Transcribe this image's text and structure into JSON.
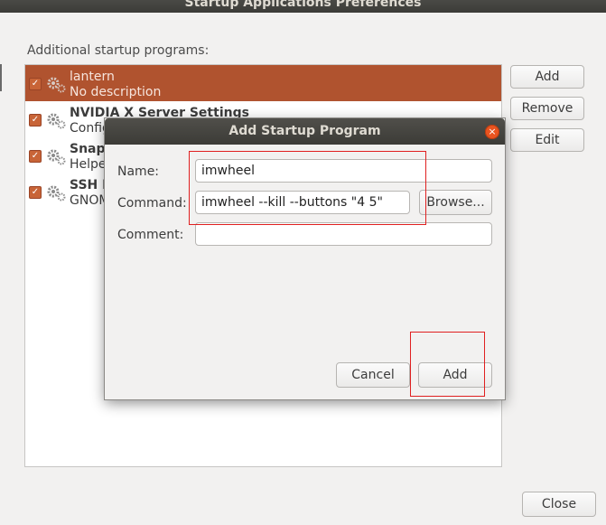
{
  "window": {
    "title": "Startup Applications Preferences"
  },
  "list_label": "Additional startup programs:",
  "programs": [
    {
      "name": "lantern",
      "description": "No description",
      "checked": true,
      "selected": true
    },
    {
      "name": "NVIDIA X Server Settings",
      "description": "Configu",
      "checked": true,
      "selected": false
    },
    {
      "name": "Snap",
      "description": "Helpe",
      "checked": true,
      "selected": false
    },
    {
      "name": "SSH K",
      "description": "GNOM",
      "checked": true,
      "selected": false
    }
  ],
  "side_buttons": {
    "add": "Add",
    "remove": "Remove",
    "edit": "Edit"
  },
  "close_label": "Close",
  "dialog": {
    "title": "Add Startup Program",
    "close_glyph": "×",
    "name_label": "Name:",
    "name_value": "imwheel",
    "command_label": "Command:",
    "command_value": "imwheel --kill --buttons \"4 5\"",
    "browse_label": "Browse...",
    "comment_label": "Comment:",
    "comment_value": "",
    "cancel_label": "Cancel",
    "add_label": "Add"
  },
  "check_glyph": "✓",
  "colors": {
    "accent": "#e95420",
    "selection": "#b0532f",
    "highlight": "#e02020"
  }
}
